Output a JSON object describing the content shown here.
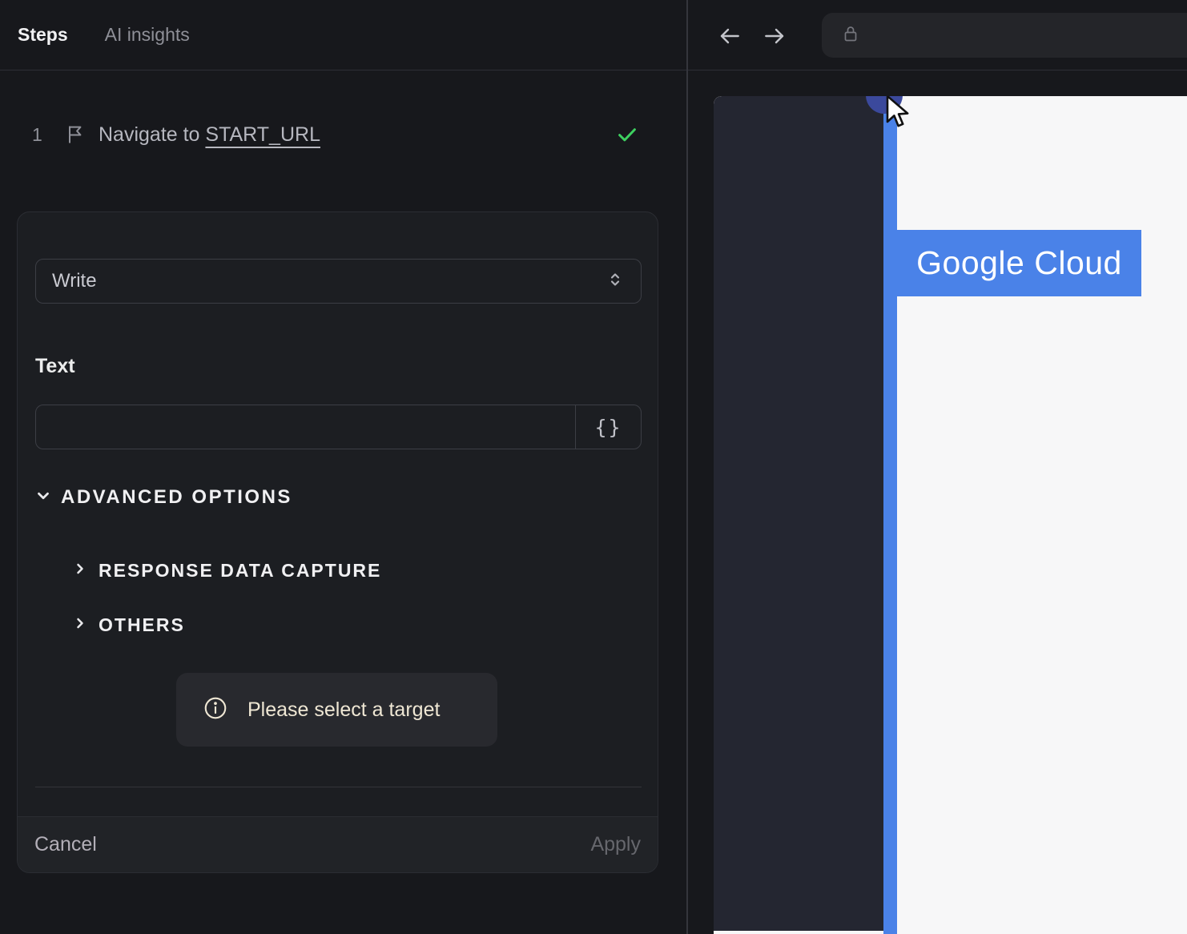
{
  "left_panel": {
    "tabs": [
      {
        "label": "Steps",
        "active": true
      },
      {
        "label": "AI insights",
        "active": false
      }
    ],
    "step": {
      "index": "1",
      "title_prefix": "Navigate to ",
      "title_link": "START_URL",
      "status": "success"
    },
    "editor": {
      "action_select_value": "Write",
      "text_label": "Text",
      "text_value": "",
      "variable_button_label": "{}",
      "advanced_options_label": "ADVANCED OPTIONS",
      "sections": [
        {
          "label": "RESPONSE DATA CAPTURE"
        },
        {
          "label": "OTHERS"
        }
      ],
      "notice_text": "Please select a target",
      "cancel_label": "Cancel",
      "apply_label": "Apply"
    }
  },
  "right_panel": {
    "browser": {
      "url_value": ""
    },
    "page": {
      "banner_text": "Google Cloud"
    }
  },
  "icons": [
    "flag-icon",
    "check-icon",
    "unfold-icon",
    "chevron-down-icon",
    "chevron-right-icon",
    "info-icon",
    "back-arrow-icon",
    "forward-arrow-icon",
    "lock-icon",
    "mouse-cursor"
  ],
  "colors": {
    "accent_blue": "#4a82e8",
    "success_green": "#3ed160",
    "notice_cream": "#efe7d4",
    "highlight_indigo": "#3b499c"
  }
}
